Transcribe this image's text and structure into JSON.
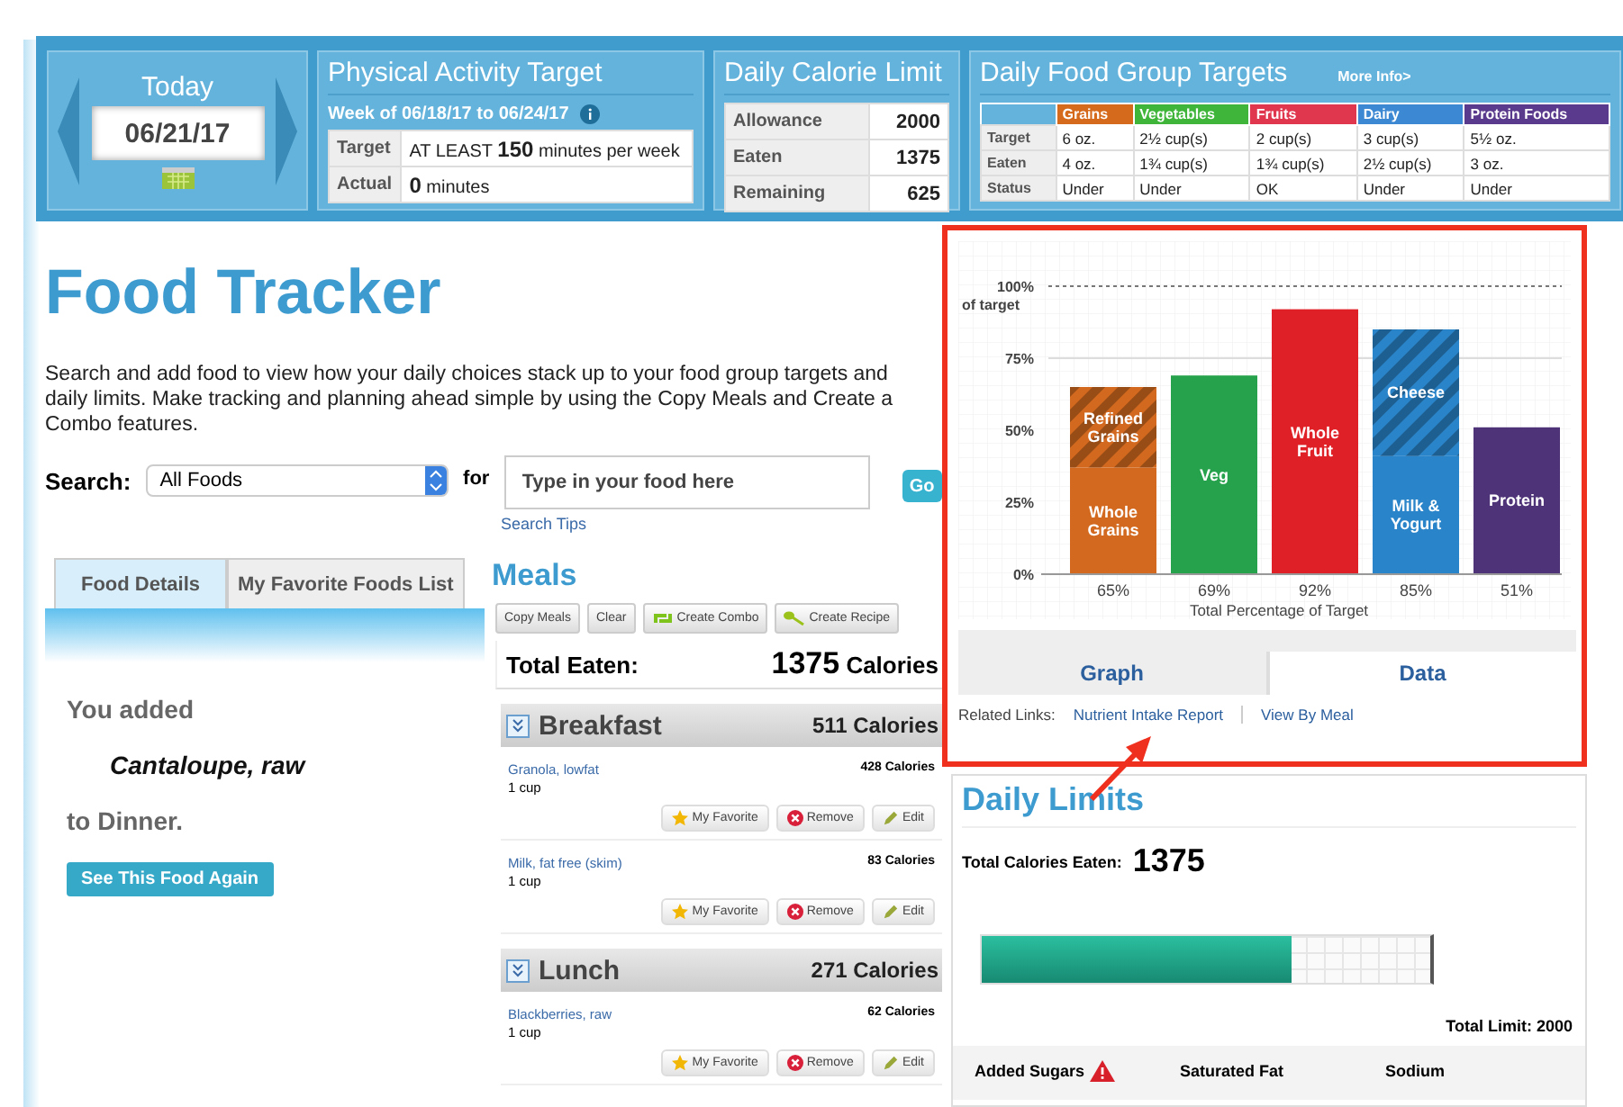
{
  "today": {
    "label": "Today",
    "date": "06/21/17"
  },
  "activity": {
    "title": "Physical Activity Target",
    "week": "Week of 06/18/17 to 06/24/17",
    "rows": [
      {
        "label": "Target",
        "before": "AT LEAST ",
        "value": "150",
        "after": " minutes per week"
      },
      {
        "label": "Actual",
        "before": "",
        "value": "0",
        "after": "  minutes"
      }
    ]
  },
  "calorie_limit": {
    "title": "Daily Calorie Limit",
    "rows": [
      {
        "label": "Allowance",
        "value": "2000"
      },
      {
        "label": "Eaten",
        "value": "1375"
      },
      {
        "label": "Remaining",
        "value": "625"
      }
    ]
  },
  "food_groups": {
    "title": "Daily Food Group Targets",
    "more_link": "More Info>",
    "row_labels": [
      "Target",
      "Eaten",
      "Status"
    ],
    "columns": [
      {
        "name": "Grains",
        "color": "#d66a1c",
        "cells": [
          "6 oz.",
          "4 oz.",
          "Under"
        ]
      },
      {
        "name": "Vegetables",
        "color": "#3fb53a",
        "cells": [
          "2½ cup(s)",
          "1¾ cup(s)",
          "Under"
        ]
      },
      {
        "name": "Fruits",
        "color": "#e0364e",
        "cells": [
          "2 cup(s)",
          "1¾ cup(s)",
          "OK"
        ]
      },
      {
        "name": "Dairy",
        "color": "#3c88d2",
        "cells": [
          "3 cup(s)",
          "2½ cup(s)",
          "Under"
        ]
      },
      {
        "name": "Protein Foods",
        "color": "#5a3a8c",
        "cells": [
          "5½ oz.",
          "3 oz.",
          "Under"
        ]
      }
    ]
  },
  "title": "Food Tracker",
  "intro": "Search and add food to view how your daily choices stack up to your food group targets and daily limits. Make tracking and planning ahead simple by using the Copy Meals and Create a Combo features.",
  "search": {
    "label": "Search:",
    "category": "All Foods",
    "for": "for",
    "placeholder": "Type in your food here",
    "go": "Go",
    "tips": "Search Tips"
  },
  "tabs": [
    {
      "label": "Food Details",
      "selected": true
    },
    {
      "label": "My Favorite Foods List",
      "selected": false
    }
  ],
  "added": {
    "line1": "You added",
    "food": "Cantaloupe, raw",
    "line2": "to Dinner.",
    "button": "See This Food Again"
  },
  "meals": {
    "title": "Meals",
    "toolbar": [
      {
        "label": "Copy Meals",
        "kind": "plain"
      },
      {
        "label": "Clear",
        "kind": "plain"
      },
      {
        "label": "Create Combo",
        "kind": "combo"
      },
      {
        "label": "Create Recipe",
        "kind": "recipe"
      }
    ],
    "total_label": "Total Eaten:",
    "total_value": "1375",
    "total_unit": "Calories",
    "groups": [
      {
        "name": "Breakfast",
        "calories": "511 Calories",
        "items": [
          {
            "name": "Granola, lowfat",
            "amount": "1 cup",
            "calories": "428 Calories",
            "buttons": [
              {
                "label": "My Favorite",
                "kind": "favorite"
              },
              {
                "label": "Remove",
                "kind": "remove"
              },
              {
                "label": "Edit",
                "kind": "edit"
              }
            ]
          },
          {
            "name": "Milk, fat free (skim)",
            "amount": "1 cup",
            "calories": "83 Calories",
            "buttons": [
              {
                "label": "My Favorite",
                "kind": "favorite"
              },
              {
                "label": "Remove",
                "kind": "remove"
              },
              {
                "label": "Edit",
                "kind": "edit"
              }
            ]
          }
        ]
      },
      {
        "name": "Lunch",
        "calories": "271 Calories",
        "items": [
          {
            "name": "Blackberries, raw",
            "amount": "1 cup",
            "calories": "62 Calories",
            "buttons": [
              {
                "label": "My Favorite",
                "kind": "favorite"
              },
              {
                "label": "Remove",
                "kind": "remove"
              },
              {
                "label": "Edit",
                "kind": "edit"
              }
            ]
          }
        ]
      }
    ]
  },
  "chart": {
    "chart_data": {
      "type": "bar",
      "stacked": true,
      "xlabel": "Total Percentage of Target",
      "ylabel": "of target",
      "categories": [
        "65%",
        "69%",
        "92%",
        "85%",
        "51%"
      ],
      "ylim": [
        0,
        100
      ],
      "yticks": [
        {
          "value": 0,
          "label": "0%"
        },
        {
          "value": 25,
          "label": "25%"
        },
        {
          "value": 50,
          "label": "50%"
        },
        {
          "value": 75,
          "label": "75%"
        },
        {
          "value": 100,
          "label": "100%"
        }
      ],
      "series": [
        {
          "name": "Refined Grains",
          "color": "#d2691e",
          "values": [
            28,
            null,
            null,
            null,
            null
          ]
        },
        {
          "name": "Whole Grains",
          "color": "#d2691e",
          "values": [
            37,
            null,
            null,
            null,
            null
          ]
        },
        {
          "name": "Veg",
          "color": "#27a24c",
          "values": [
            null,
            69,
            null,
            null,
            null
          ]
        },
        {
          "name": "Whole Fruit",
          "color": "#e02027",
          "values": [
            null,
            null,
            92,
            null,
            null
          ]
        },
        {
          "name": "Cheese",
          "color": "#2a84c9",
          "values": [
            null,
            null,
            null,
            44,
            null
          ]
        },
        {
          "name": "Milk & Yogurt",
          "color": "#2a84c9",
          "values": [
            null,
            null,
            null,
            41,
            null
          ]
        },
        {
          "name": "Protein",
          "color": "#4e3379",
          "values": [
            null,
            null,
            null,
            null,
            51
          ]
        }
      ]
    },
    "segments": [
      {
        "hatched": true
      },
      {
        "hatched": false
      },
      {
        "hatched": false
      },
      {
        "hatched": false
      },
      {
        "hatched": true
      },
      {
        "hatched": false
      },
      {
        "hatched": false
      }
    ],
    "tabs": [
      {
        "label": "Graph",
        "selected": true
      },
      {
        "label": "Data",
        "selected": false
      }
    ],
    "related_label": "Related Links:",
    "links": [
      "Nutrient Intake Report",
      "View By Meal"
    ]
  },
  "daily_limits": {
    "title": "Daily Limits",
    "total_label": "Total Calories Eaten:",
    "total_value": "1375",
    "level": 0.69,
    "limit": "Total Limit: 2000",
    "nutrients": [
      {
        "name": "Added Sugars",
        "warning": true
      },
      {
        "name": "Saturated Fat",
        "warning": false
      },
      {
        "name": "Sodium",
        "warning": false
      }
    ]
  }
}
